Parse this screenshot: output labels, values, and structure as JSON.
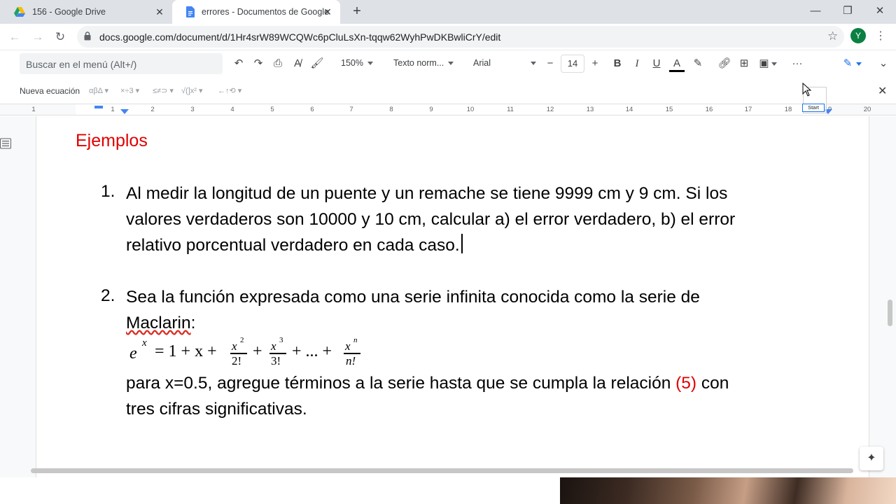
{
  "browser": {
    "tabs": [
      {
        "title": "156 - Google Drive",
        "icon": "google-drive-icon",
        "active": false
      },
      {
        "title": "errores - Documentos de Google",
        "icon": "google-docs-icon",
        "active": true
      }
    ],
    "url": "docs.google.com/document/d/1Hr4srW89WCQWc6pCluLsXn-tqqw62WyhPwDKBwliCrY/edit",
    "avatar_letter": "Y",
    "avatar_color": "#0b8043"
  },
  "toolbar": {
    "menu_search_placeholder": "Buscar en el menú (Alt+/)",
    "zoom": "150%",
    "style": "Texto norm...",
    "font": "Arial",
    "font_size": "14",
    "bold": "B",
    "italic": "I",
    "underline": "U",
    "text_color": "A",
    "more": "···"
  },
  "equation_bar": {
    "label": "Nueva ecuación",
    "groups": [
      "αβΔ",
      "×÷3",
      "≤≠⊃",
      "√(]x²",
      "←↑⟲"
    ]
  },
  "ruler": {
    "ticks": [
      "1",
      "1",
      "2",
      "3",
      "4",
      "5",
      "6",
      "7",
      "8",
      "9",
      "10",
      "11",
      "12",
      "13",
      "14",
      "15",
      "16",
      "17",
      "18",
      "19",
      "20"
    ],
    "start_label": "Start"
  },
  "document": {
    "heading": "Ejemplos",
    "item1": {
      "number": "1.",
      "lines": [
        "Al medir la longitud de un puente y un remache se tiene 9999 cm  y 9 cm. Si los",
        "valores verdaderos son 10000 y 10 cm, calcular a) el error verdadero, b) el error",
        "relativo porcentual verdadero en cada caso."
      ]
    },
    "item2": {
      "number": "2.",
      "line1": "Sea la función expresada como una serie infinita conocida como la serie de",
      "line2_word": "Maclarin",
      "line2_rest": ":",
      "equation": {
        "lhs_base": "e",
        "lhs_exp": "x",
        "eq_part": "= 1 + x +",
        "frac1_num": "x",
        "frac1_exp": "2",
        "frac1_den": "2!",
        "plus1": "+",
        "frac2_num": "x",
        "frac2_exp": "3",
        "frac2_den": "3!",
        "mid": "+ ... +",
        "frac3_num": "x",
        "frac3_exp": "n",
        "frac3_den": "n!"
      },
      "line3_a": "para x=0.5, agregue términos a la serie hasta que se cumpla la relación ",
      "line3_ref": "(5)",
      "line3_b": " con",
      "line4": "tres cifras significativas."
    }
  },
  "colors": {
    "heading": "#e00000",
    "reference": "#e00000",
    "avatar": "#0b8043",
    "docs_blue": "#4285f4"
  }
}
